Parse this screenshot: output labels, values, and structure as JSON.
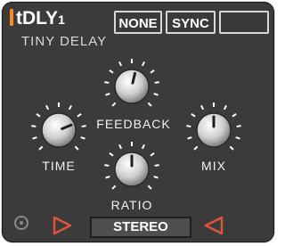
{
  "brand": {
    "name": "tDLY",
    "suffix": "1",
    "accent_color": "#ff8a1c"
  },
  "subtitle": "TINY DELAY",
  "header_buttons": {
    "none": "NONE",
    "sync": "SYNC",
    "blank": ""
  },
  "knobs": {
    "feedback": {
      "label": "FEEDBACK",
      "value": 0.55
    },
    "time": {
      "label": "TIME",
      "value": 0.75
    },
    "mix": {
      "label": "MIX",
      "value": 0.5
    },
    "ratio": {
      "label": "RATIO",
      "value": 0.5
    }
  },
  "footer": {
    "mode": "STEREO",
    "arrow_color": "#e0533b"
  }
}
